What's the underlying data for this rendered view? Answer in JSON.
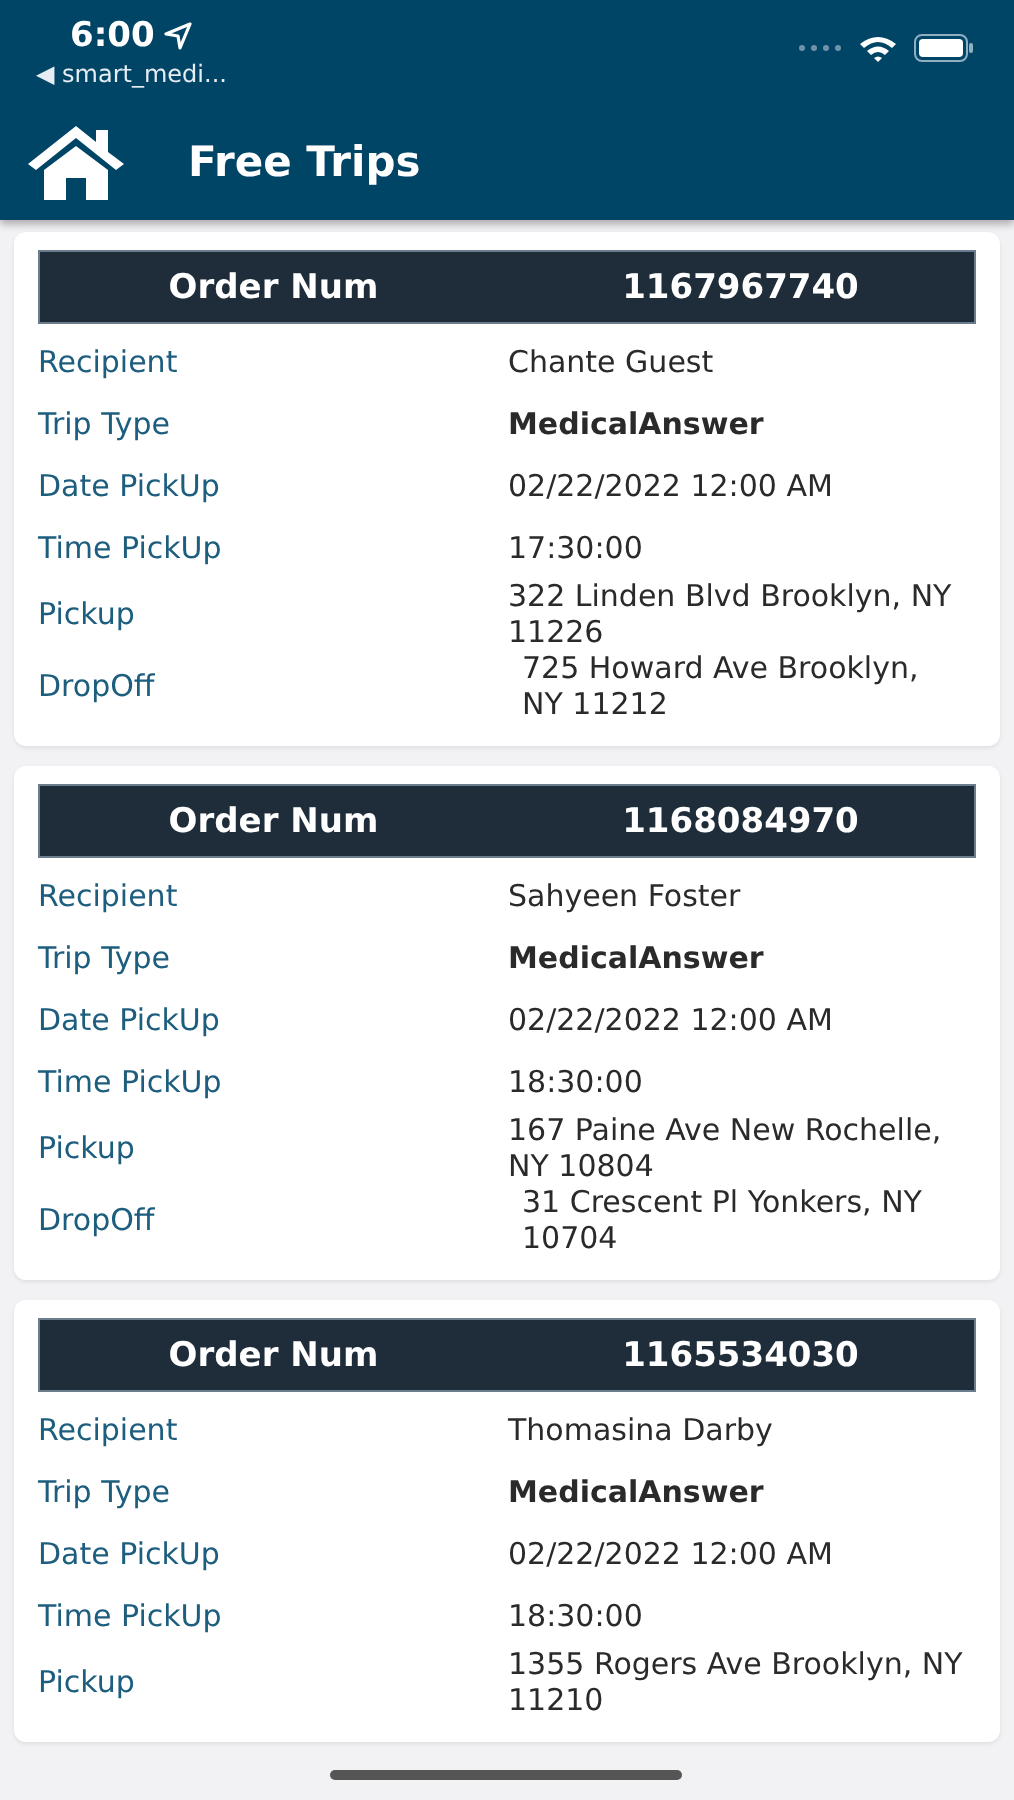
{
  "status_bar": {
    "time": "6:00",
    "back_app": "◀ smart_medi..."
  },
  "nav": {
    "title": "Free Trips"
  },
  "trips": [
    {
      "header_label": "Order Num",
      "order_num": "1167967740",
      "rows": [
        {
          "label": "Recipient",
          "value": "Chante Guest",
          "kind": "plain"
        },
        {
          "label": "Trip Type",
          "value": "MedicalAnswer",
          "kind": "bold"
        },
        {
          "label": "Date PickUp",
          "value": "02/22/2022 12:00 AM",
          "kind": "plain"
        },
        {
          "label": "Time PickUp",
          "value": "17:30:00",
          "kind": "plain"
        },
        {
          "label": "Pickup",
          "value": "322 Linden Blvd Brooklyn, NY 11226",
          "kind": "plain"
        },
        {
          "label": "DropOff",
          "value": "725 Howard Ave Brooklyn, NY 11212",
          "kind": "indented"
        }
      ]
    },
    {
      "header_label": "Order Num",
      "order_num": "1168084970",
      "rows": [
        {
          "label": "Recipient",
          "value": "Sahyeen Foster",
          "kind": "plain"
        },
        {
          "label": "Trip Type",
          "value": "MedicalAnswer",
          "kind": "bold"
        },
        {
          "label": "Date PickUp",
          "value": "02/22/2022 12:00 AM",
          "kind": "plain"
        },
        {
          "label": "Time PickUp",
          "value": "18:30:00",
          "kind": "plain"
        },
        {
          "label": "Pickup",
          "value": "167 Paine Ave New Rochelle, NY 10804",
          "kind": "plain"
        },
        {
          "label": "DropOff",
          "value": "31 Crescent Pl Yonkers, NY 10704",
          "kind": "indented"
        }
      ]
    },
    {
      "header_label": "Order Num",
      "order_num": "1165534030",
      "rows": [
        {
          "label": "Recipient",
          "value": "Thomasina Darby",
          "kind": "plain"
        },
        {
          "label": "Trip Type",
          "value": "MedicalAnswer",
          "kind": "bold"
        },
        {
          "label": "Date PickUp",
          "value": "02/22/2022 12:00 AM",
          "kind": "plain"
        },
        {
          "label": "Time PickUp",
          "value": "18:30:00",
          "kind": "plain"
        },
        {
          "label": "Pickup",
          "value": "1355 Rogers Ave Brooklyn, NY 11210",
          "kind": "plain"
        }
      ]
    }
  ]
}
